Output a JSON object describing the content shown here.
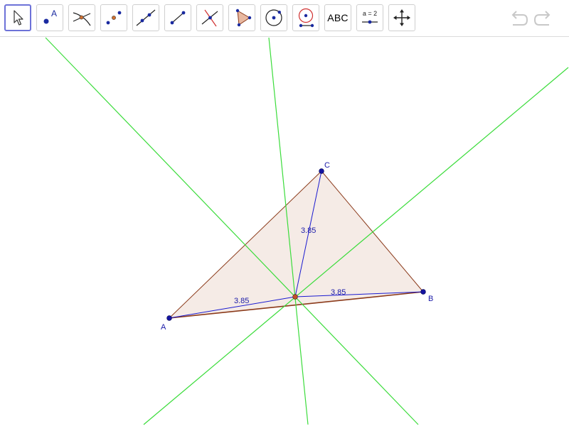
{
  "toolbar": {
    "tools": [
      {
        "name": "move-tool",
        "active": true
      },
      {
        "name": "point-tool",
        "icon_text": "A"
      },
      {
        "name": "intersect-tool"
      },
      {
        "name": "midpoint-tool"
      },
      {
        "name": "line-tool"
      },
      {
        "name": "segment-tool"
      },
      {
        "name": "perpendicular-line-tool"
      },
      {
        "name": "polygon-tool"
      },
      {
        "name": "circle-center-point-tool"
      },
      {
        "name": "circle-center-radius-tool"
      },
      {
        "name": "text-tool",
        "label": "ABC"
      },
      {
        "name": "slider-tool",
        "label": "a = 2"
      },
      {
        "name": "move-graphics-view-tool"
      }
    ]
  },
  "construction": {
    "points": [
      {
        "name": "A",
        "label": "A"
      },
      {
        "name": "B",
        "label": "B"
      },
      {
        "name": "C",
        "label": "C"
      }
    ],
    "segment_labels": [
      {
        "name": "AO",
        "value": "3.85"
      },
      {
        "name": "BO",
        "value": "3.85"
      },
      {
        "name": "CO",
        "value": "3.85"
      }
    ],
    "colors": {
      "polygon_fill": "#f5ebe6",
      "polygon_edge": "#8b3a1a",
      "bisector": "#3bdc3b",
      "radius": "#1a1ad0",
      "point": "#1414a0",
      "center_point": "#c0502a"
    }
  }
}
